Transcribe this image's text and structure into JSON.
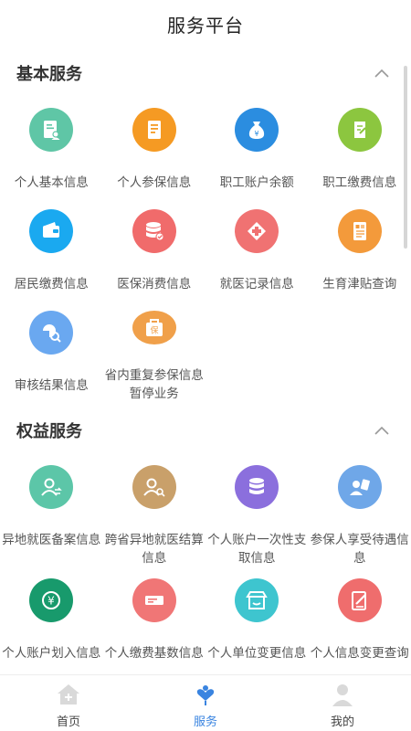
{
  "header": {
    "title": "服务平台"
  },
  "sections": [
    {
      "title": "基本服务",
      "items": [
        {
          "label": "个人基本信息",
          "color": "#5fc6a6",
          "icon": "id-card-icon"
        },
        {
          "label": "个人参保信息",
          "color": "#f59a23",
          "icon": "document-icon"
        },
        {
          "label": "职工账户余额",
          "color": "#2b8de0",
          "icon": "money-bag-icon"
        },
        {
          "label": "职工缴费信息",
          "color": "#8cc63f",
          "icon": "paper-edit-icon"
        },
        {
          "label": "居民缴费信息",
          "color": "#1aa9f0",
          "icon": "wallet-icon"
        },
        {
          "label": "医保消费信息",
          "color": "#f06b6b",
          "icon": "database-check-icon"
        },
        {
          "label": "就医记录信息",
          "color": "#f07272",
          "icon": "medical-cross-icon"
        },
        {
          "label": "生育津贴查询",
          "color": "#f39a3b",
          "icon": "form-icon"
        },
        {
          "label": "审核结果信息",
          "color": "#6aa8f0",
          "icon": "audit-search-icon"
        },
        {
          "label": "省内重复参保信息暂停业务",
          "color": "#f0a04a",
          "icon": "protect-bag-icon"
        }
      ]
    },
    {
      "title": "权益服务",
      "items": [
        {
          "label": "异地就医备案信息",
          "color": "#5cc6a8",
          "icon": "user-transfer-icon"
        },
        {
          "label": "跨省异地就医结算信息",
          "color": "#c9a06a",
          "icon": "user-search-icon"
        },
        {
          "label": "个人账户一次性支取信息",
          "color": "#8b6fdd",
          "icon": "database-icon"
        },
        {
          "label": "参保人享受待遇信息",
          "color": "#6fa7e8",
          "icon": "user-doc-icon"
        },
        {
          "label": "个人账户划入信息",
          "color": "#189a6c",
          "icon": "yuan-icon"
        },
        {
          "label": "个人缴费基数信息",
          "color": "#f07676",
          "icon": "ticket-icon"
        },
        {
          "label": "个人单位变更信息",
          "color": "#3ec5cf",
          "icon": "store-icon"
        },
        {
          "label": "个人信息变更查询",
          "color": "#ef6d6d",
          "icon": "edit-doc-icon"
        }
      ]
    }
  ],
  "tabbar": [
    {
      "label": "首页",
      "icon": "home-icon"
    },
    {
      "label": "服务",
      "icon": "service-icon",
      "active": true
    },
    {
      "label": "我的",
      "icon": "user-icon"
    }
  ]
}
